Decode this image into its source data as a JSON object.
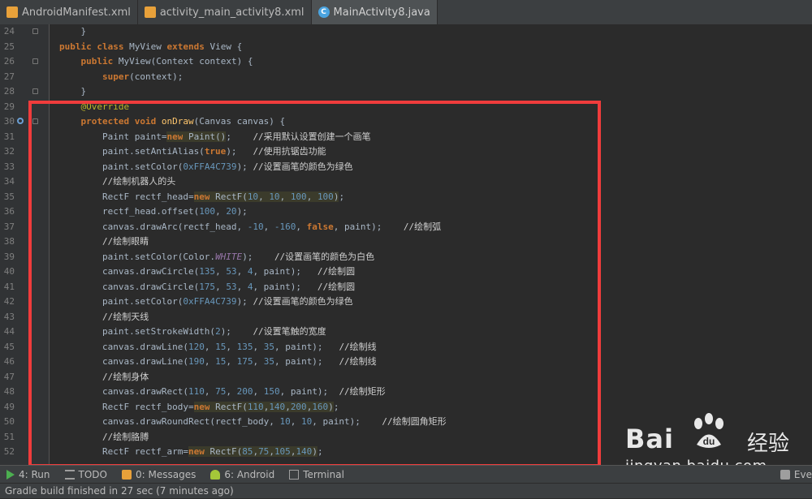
{
  "tabs": [
    {
      "label": "AndroidManifest.xml",
      "type": "xml",
      "active": false
    },
    {
      "label": "activity_main_activity8.xml",
      "type": "xml",
      "active": false
    },
    {
      "label": "MainActivity8.java",
      "type": "java",
      "active": true
    }
  ],
  "code_lines": [
    {
      "n": "24",
      "html": "    }"
    },
    {
      "n": "25",
      "html": "<span class=\"kw\">public class</span> MyView <span class=\"kw\">extends</span> View {"
    },
    {
      "n": "26",
      "html": "    <span class=\"kw\">public</span> MyView(Context context) {"
    },
    {
      "n": "27",
      "html": "        <span class=\"kw\">super</span>(context);"
    },
    {
      "n": "28",
      "html": "    }"
    },
    {
      "n": "29",
      "html": "    <span class=\"ann\">@Override</span>"
    },
    {
      "n": "30",
      "html": "    <span class=\"kw\">protected void</span> <span class=\"fn\">onDraw</span>(Canvas canvas) {"
    },
    {
      "n": "31",
      "html": "        Paint paint=<span class=\"kw hl\">new</span><span class=\"hl\"> Paint()</span>;    <span class=\"cm\">//采用默认设置创建一个画笔</span>"
    },
    {
      "n": "32",
      "html": "        paint.setAntiAlias(<span class=\"kw\">true</span>);   <span class=\"cm\">//使用抗锯齿功能</span>"
    },
    {
      "n": "33",
      "html": "        paint.setColor(<span class=\"num\">0xFFA4C739</span>); <span class=\"cm\">//设置画笔的颜色为绿色</span>"
    },
    {
      "n": "34",
      "html": "        <span class=\"cm\">//绘制机器人的头</span>"
    },
    {
      "n": "35",
      "html": "        RectF rectf_head=<span class=\"kw hl\">new</span><span class=\"hl\"> RectF(<span class=\"num\">10</span>, <span class=\"num\">10</span>, <span class=\"num\">100</span>, <span class=\"num\">100</span>)</span>;"
    },
    {
      "n": "36",
      "html": "        rectf_head.offset(<span class=\"num\">100</span>, <span class=\"num\">20</span>);"
    },
    {
      "n": "37",
      "html": "        canvas.drawArc(rectf_head, <span class=\"num\">-10</span>, <span class=\"num\">-160</span>, <span class=\"kw\">false</span>, paint);    <span class=\"cm\">//绘制弧</span>"
    },
    {
      "n": "38",
      "html": "        <span class=\"cm\">//绘制眼睛</span>"
    },
    {
      "n": "39",
      "html": "        paint.setColor(Color.<span class=\"cst\">WHITE</span>);    <span class=\"cm\">//设置画笔的颜色为白色</span>"
    },
    {
      "n": "40",
      "html": "        canvas.drawCircle(<span class=\"num\">135</span>, <span class=\"num\">53</span>, <span class=\"num\">4</span>, paint);   <span class=\"cm\">//绘制圆</span>"
    },
    {
      "n": "41",
      "html": "        canvas.drawCircle(<span class=\"num\">175</span>, <span class=\"num\">53</span>, <span class=\"num\">4</span>, paint);   <span class=\"cm\">//绘制圆</span>"
    },
    {
      "n": "42",
      "html": "        paint.setColor(<span class=\"num\">0xFFA4C739</span>); <span class=\"cm\">//设置画笔的颜色为绿色</span>"
    },
    {
      "n": "43",
      "html": "        <span class=\"cm\">//绘制天线</span>"
    },
    {
      "n": "44",
      "html": "        paint.setStrokeWidth(<span class=\"num\">2</span>);    <span class=\"cm\">//设置笔触的宽度</span>"
    },
    {
      "n": "45",
      "html": "        canvas.drawLine(<span class=\"num\">120</span>, <span class=\"num\">15</span>, <span class=\"num\">135</span>, <span class=\"num\">35</span>, paint);   <span class=\"cm\">//绘制线</span>"
    },
    {
      "n": "46",
      "html": "        canvas.drawLine(<span class=\"num\">190</span>, <span class=\"num\">15</span>, <span class=\"num\">175</span>, <span class=\"num\">35</span>, paint);   <span class=\"cm\">//绘制线</span>"
    },
    {
      "n": "47",
      "html": "        <span class=\"cm\">//绘制身体</span>"
    },
    {
      "n": "48",
      "html": "        canvas.drawRect(<span class=\"num\">110</span>, <span class=\"num\">75</span>, <span class=\"num\">200</span>, <span class=\"num\">150</span>, paint);  <span class=\"cm\">//绘制矩形</span>"
    },
    {
      "n": "49",
      "html": "        RectF rectf_body=<span class=\"kw hl\">new</span><span class=\"hl\"> RectF(<span class=\"num\">110</span>,<span class=\"num\">140</span>,<span class=\"num\">200</span>,<span class=\"num\">160</span>)</span>;"
    },
    {
      "n": "50",
      "html": "        canvas.drawRoundRect(rectf_body, <span class=\"num\">10</span>, <span class=\"num\">10</span>, paint);    <span class=\"cm\">//绘制圆角矩形</span>"
    },
    {
      "n": "51",
      "html": "        <span class=\"cm\">//绘制胳膊</span>"
    },
    {
      "n": "52",
      "html": "        RectF rectf_arm=<span class=\"kw hl\">new</span><span class=\"hl\"> RectF(<span class=\"num\">85</span>,<span class=\"num\">75</span>,<span class=\"num\">105</span>,<span class=\"num\">140</span>)</span>;"
    }
  ],
  "tool_windows": [
    {
      "label": "4: Run",
      "icon": "run-icon",
      "color": "#4caf50"
    },
    {
      "label": "TODO",
      "icon": "todo-icon",
      "color": "#9e9e9e"
    },
    {
      "label": "0: Messages",
      "icon": "messages-icon",
      "color": "#e8a13a"
    },
    {
      "label": "6: Android",
      "icon": "android-icon",
      "color": "#a4c739"
    },
    {
      "label": "Terminal",
      "icon": "terminal-icon",
      "color": "#9e9e9e"
    }
  ],
  "event_log": "Eve",
  "status": "Gradle build finished in 27 sec (7 minutes ago)",
  "watermark": {
    "brand": "Bai",
    "brand_tail": "经验",
    "domain": "jingyan.baidu.com"
  },
  "colors": {
    "highlight_box": "#f03c3c"
  }
}
